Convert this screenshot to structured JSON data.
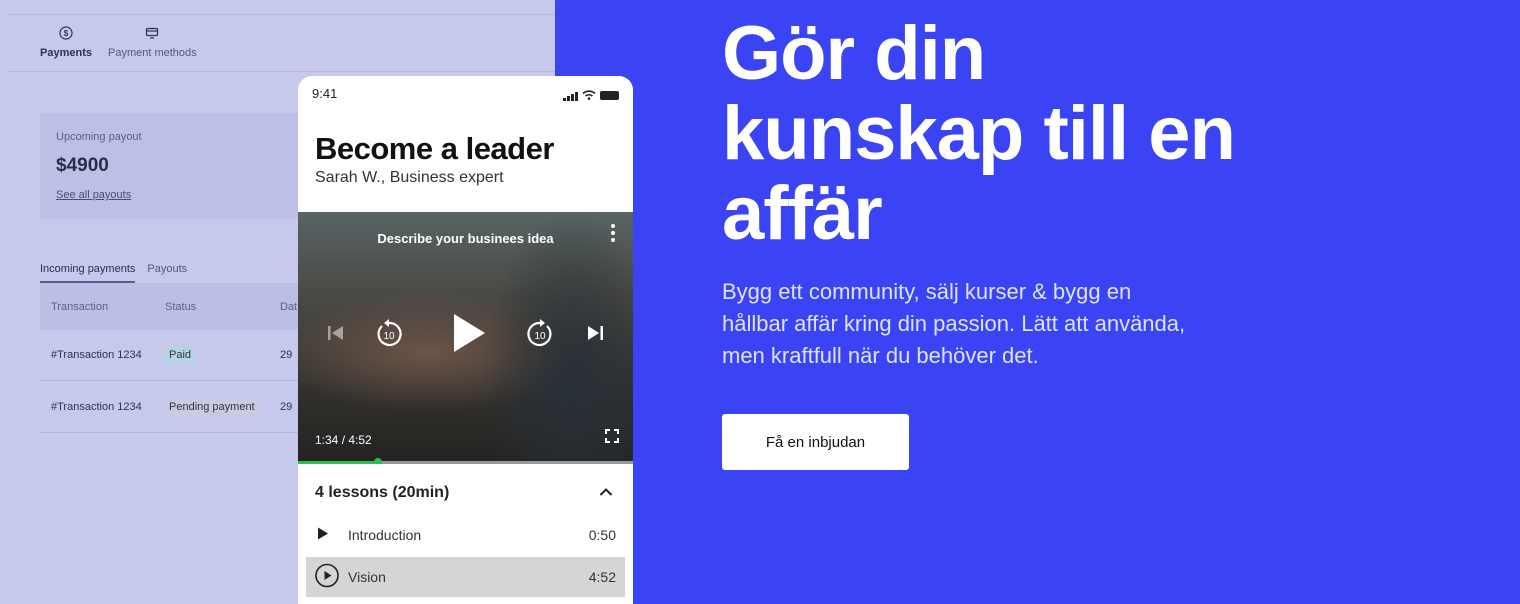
{
  "dashboard": {
    "tabs": [
      {
        "label": "Payments",
        "icon": "dollar-circle-icon"
      },
      {
        "label": "Payment methods",
        "icon": "card-icon"
      }
    ],
    "payout": {
      "label": "Upcoming payout",
      "amount": "$4900",
      "link": "See all payouts"
    },
    "sub_tabs": [
      "Incoming payments",
      "Payouts"
    ],
    "table": {
      "columns": [
        "Transaction",
        "Status",
        "Dat"
      ],
      "rows": [
        {
          "transaction": "#Transaction 1234",
          "status": "Paid",
          "date": "29"
        },
        {
          "transaction": "#Transaction 1234",
          "status": "Pending payment",
          "date": "29"
        }
      ]
    }
  },
  "phone": {
    "time": "9:41",
    "course_title": "Become a leader",
    "author": "Sarah W., Business expert",
    "video": {
      "caption": "Describe your businees idea",
      "time": "1:34 / 4:52",
      "progress": 0.24,
      "skip_seconds": "10"
    },
    "lessons_header": "4 lessons (20min)",
    "lessons": [
      {
        "title": "Introduction",
        "duration": "0:50",
        "icon": "play-icon"
      },
      {
        "title": "Vision",
        "duration": "4:52",
        "icon": "play-circle-icon"
      }
    ]
  },
  "hero": {
    "title": "Gör din kunskap till en affär",
    "subtitle": "Bygg ett community, sälj kurser & bygg en hållbar affär kring din passion. Lätt att använda, men kraftfull när du behöver det.",
    "cta": "Få en inbjudan"
  },
  "colors": {
    "background": "#3a44f5",
    "dashboard": "#c6c8ec",
    "progress": "#2bbf5a",
    "cta_bg": "#ffffff"
  }
}
